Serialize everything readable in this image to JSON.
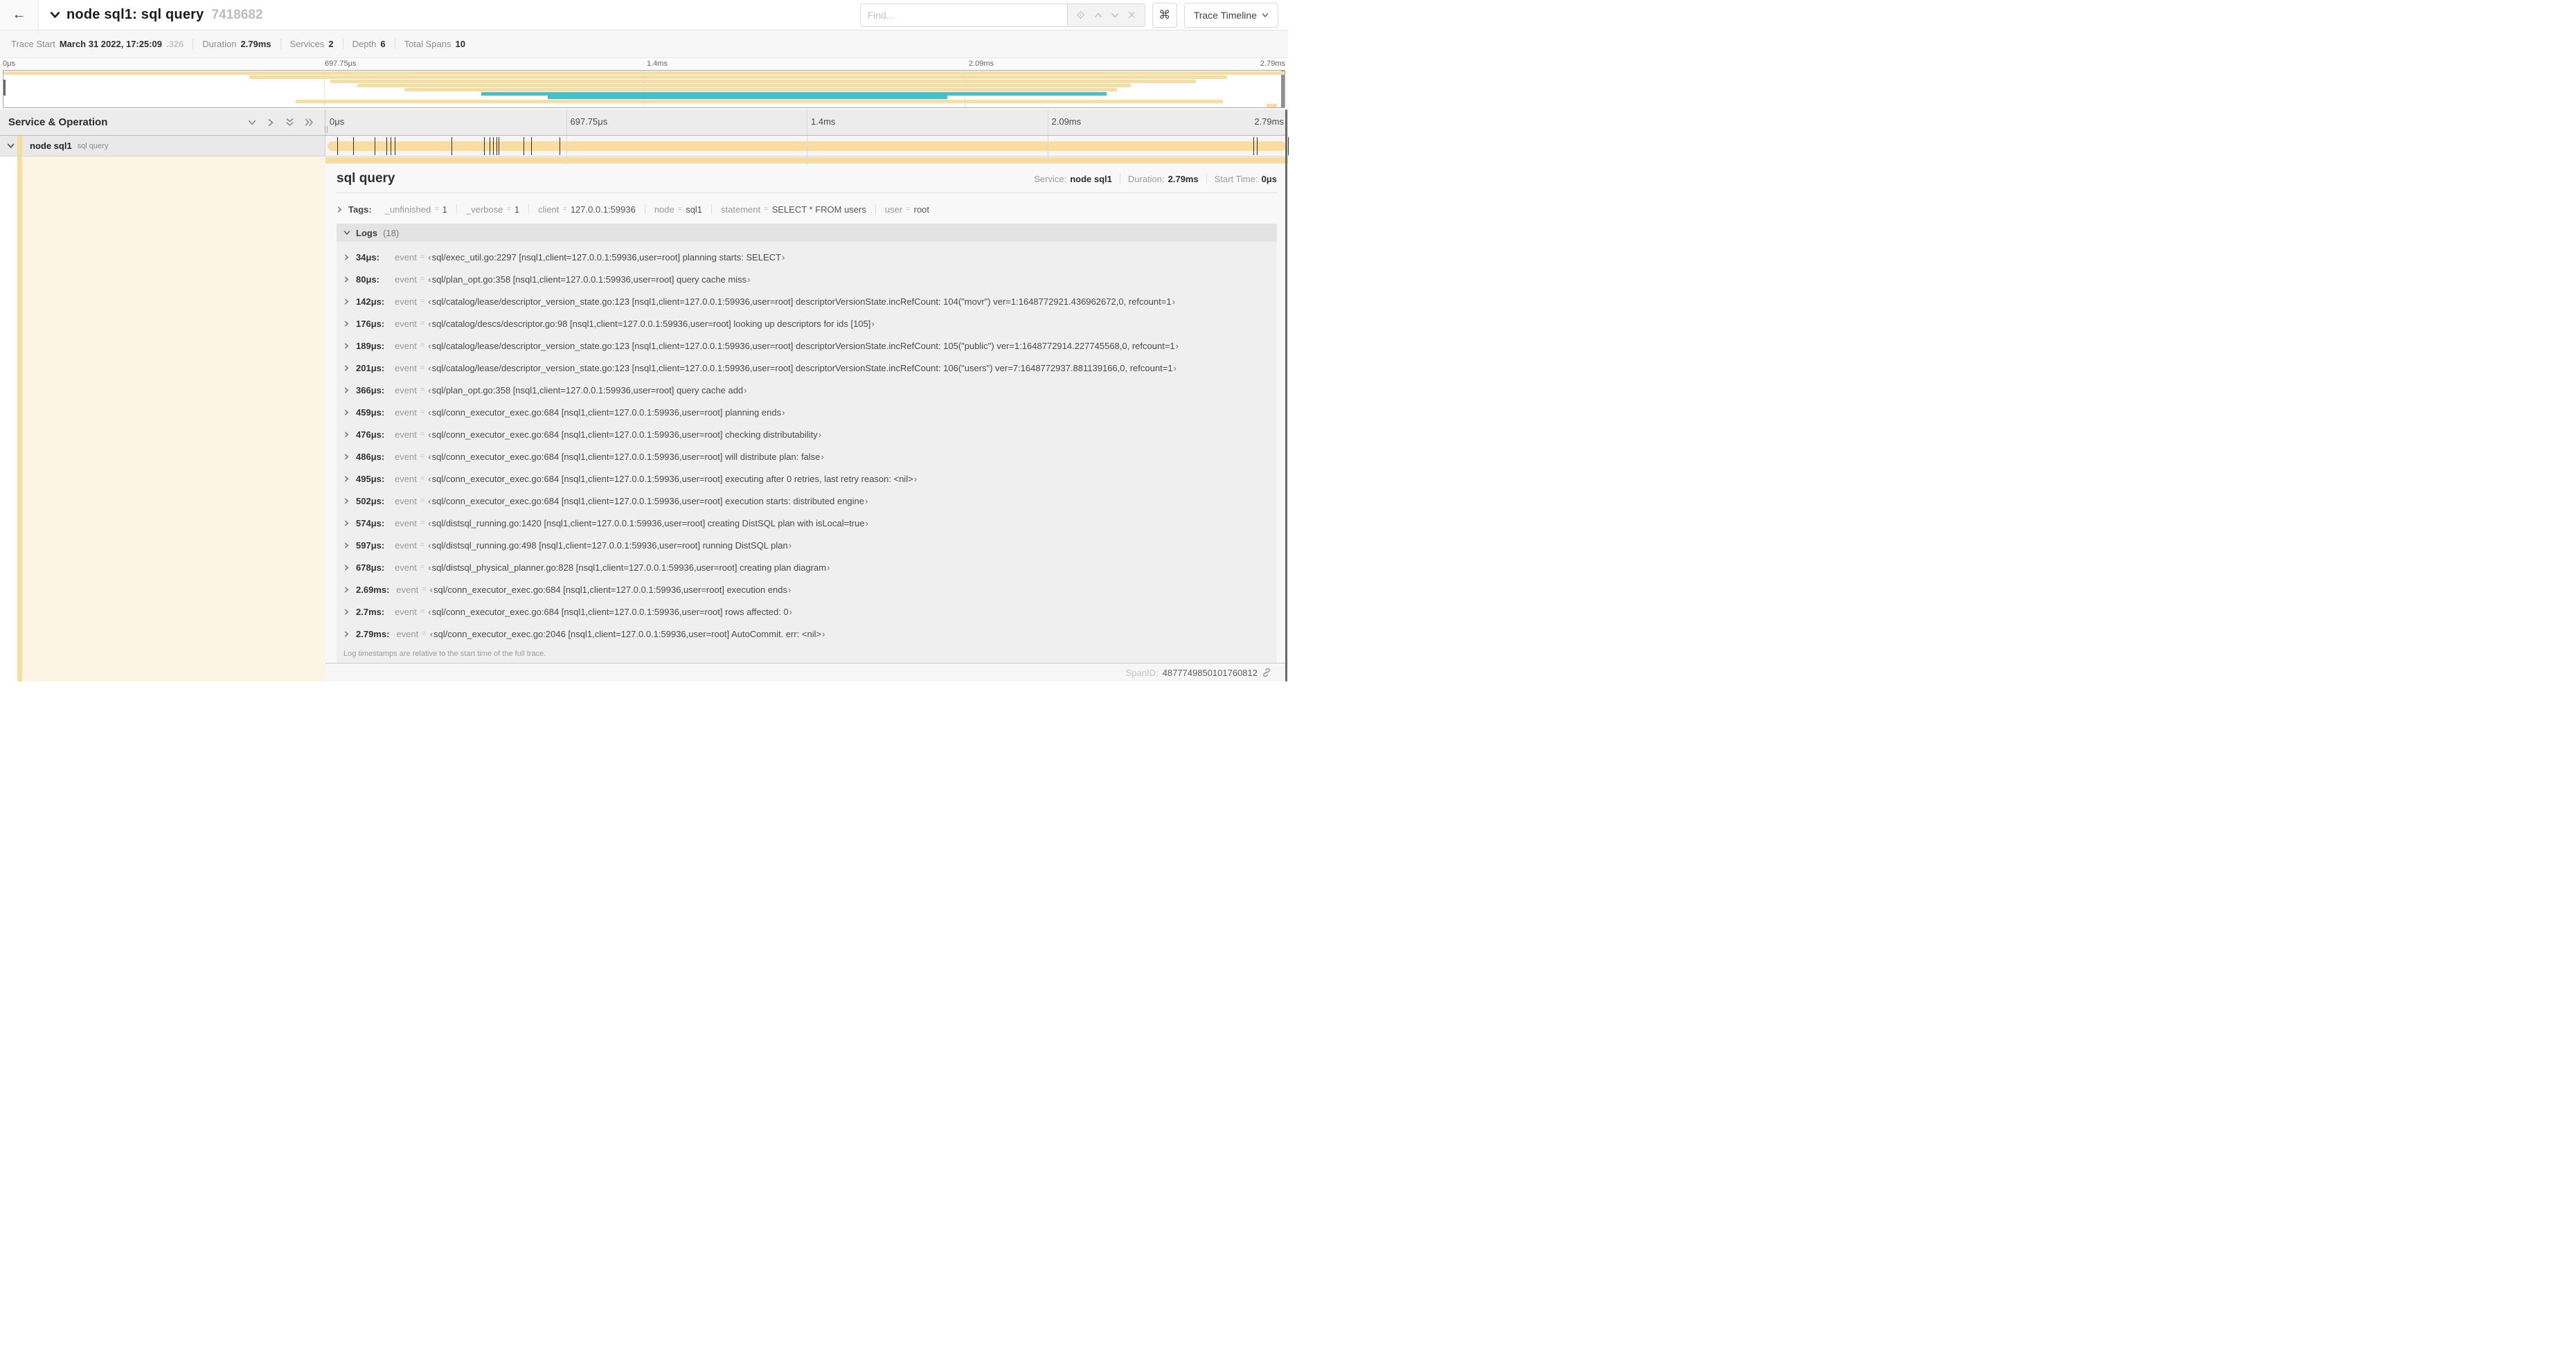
{
  "header": {
    "title": "node sql1: sql query",
    "trace_id": "7418682",
    "find_placeholder": "Find...",
    "view_button": "Trace Timeline",
    "keyboard_shortcut_glyph": "⌘",
    "back_glyph": "←"
  },
  "icons": {
    "back": "arrow-left",
    "title_collapse": "chevron-down",
    "find_target": "crosshair",
    "find_prev": "chevron-up",
    "find_next": "chevron-down",
    "find_clear": "x",
    "keyboard": "command",
    "view_caret": "chevron-down",
    "collapse_one": "chevron-down",
    "expand_one": "chevron-right",
    "collapse_all": "double-chevron-down",
    "expand_all": "double-chevron-right",
    "span_toggle": "chevron-down",
    "tags_toggle": "chevron-right",
    "logs_toggle": "chevron-down",
    "log_row_toggle": "chevron-right",
    "span_link": "link"
  },
  "stats": {
    "items": [
      {
        "label": "Trace Start",
        "value": "March 31 2022, 17:25:09",
        "suffix": ".326"
      },
      {
        "label": "Duration",
        "value": "2.79ms"
      },
      {
        "label": "Services",
        "value": "2"
      },
      {
        "label": "Depth",
        "value": "6"
      },
      {
        "label": "Total Spans",
        "value": "10"
      }
    ]
  },
  "trace": {
    "total_us": 2790
  },
  "minimap": {
    "tick_labels": [
      "0μs",
      "697.75μs",
      "1.4ms",
      "2.09ms",
      "2.79ms"
    ],
    "spans": [
      {
        "row": 0,
        "start": 0,
        "end": 100,
        "color": "yellow"
      },
      {
        "row": 1,
        "start": 19.2,
        "end": 95.5,
        "color": "yellow"
      },
      {
        "row": 2,
        "start": 25.5,
        "end": 93.1,
        "color": "yellow"
      },
      {
        "row": 3,
        "start": 27.6,
        "end": 88.0,
        "color": "yellow"
      },
      {
        "row": 4,
        "start": 31.3,
        "end": 86.9,
        "color": "yellow"
      },
      {
        "row": 5,
        "start": 37.3,
        "end": 86.1,
        "color": "teal"
      },
      {
        "row": 6,
        "start": 42.5,
        "end": 73.7,
        "color": "teal"
      },
      {
        "row": 7,
        "start": 22.8,
        "end": 95.2,
        "color": "yellow"
      },
      {
        "row": 8,
        "start": 98.6,
        "end": 99.4,
        "color": "yellow"
      }
    ]
  },
  "timeline": {
    "left_header": "Service & Operation",
    "axis_ticks": [
      "0μs",
      "697.75μs",
      "1.4ms",
      "2.09ms",
      "2.79ms"
    ]
  },
  "row": {
    "service": "node sql1",
    "operation": "sql query"
  },
  "detail": {
    "title": "sql query",
    "meta": [
      {
        "label": "Service:",
        "value": "node sql1"
      },
      {
        "label": "Duration:",
        "value": "2.79ms"
      },
      {
        "label": "Start Time:",
        "value": "0μs"
      }
    ],
    "tags_label": "Tags:",
    "tags": [
      {
        "key": "_unfinished",
        "value": "1"
      },
      {
        "key": "_verbose",
        "value": "1"
      },
      {
        "key": "client",
        "value": "127.0.0.1:59936"
      },
      {
        "key": "node",
        "value": "sql1"
      },
      {
        "key": "statement",
        "value": "SELECT * FROM users"
      },
      {
        "key": "user",
        "value": "root"
      }
    ],
    "logs_label": "Logs",
    "logs_count": "(18)",
    "logs": [
      {
        "t": "34μs:",
        "t_us": 34,
        "field": "event",
        "value": "sql/exec_util.go:2297 [nsql1,client=127.0.0.1:59936,user=root] planning starts: SELECT"
      },
      {
        "t": "80μs:",
        "t_us": 80,
        "field": "event",
        "value": "sql/plan_opt.go:358 [nsql1,client=127.0.0.1:59936,user=root] query cache miss"
      },
      {
        "t": "142μs:",
        "t_us": 142,
        "field": "event",
        "value": "sql/catalog/lease/descriptor_version_state.go:123 [nsql1,client=127.0.0.1:59936,user=root] descriptorVersionState.incRefCount: 104(\"movr\") ver=1:1648772921.436962672,0, refcount=1"
      },
      {
        "t": "176μs:",
        "t_us": 176,
        "field": "event",
        "value": "sql/catalog/descs/descriptor.go:98 [nsql1,client=127.0.0.1:59936,user=root] looking up descriptors for ids [105]"
      },
      {
        "t": "189μs:",
        "t_us": 189,
        "field": "event",
        "value": "sql/catalog/lease/descriptor_version_state.go:123 [nsql1,client=127.0.0.1:59936,user=root] descriptorVersionState.incRefCount: 105(\"public\") ver=1:1648772914.227745568,0, refcount=1"
      },
      {
        "t": "201μs:",
        "t_us": 201,
        "field": "event",
        "value": "sql/catalog/lease/descriptor_version_state.go:123 [nsql1,client=127.0.0.1:59936,user=root] descriptorVersionState.incRefCount: 106(\"users\") ver=7:1648772937.881139166,0, refcount=1"
      },
      {
        "t": "366μs:",
        "t_us": 366,
        "field": "event",
        "value": "sql/plan_opt.go:358 [nsql1,client=127.0.0.1:59936,user=root] query cache add"
      },
      {
        "t": "459μs:",
        "t_us": 459,
        "field": "event",
        "value": "sql/conn_executor_exec.go:684 [nsql1,client=127.0.0.1:59936,user=root] planning ends"
      },
      {
        "t": "476μs:",
        "t_us": 476,
        "field": "event",
        "value": "sql/conn_executor_exec.go:684 [nsql1,client=127.0.0.1:59936,user=root] checking distributability"
      },
      {
        "t": "486μs:",
        "t_us": 486,
        "field": "event",
        "value": "sql/conn_executor_exec.go:684 [nsql1,client=127.0.0.1:59936,user=root] will distribute plan: false"
      },
      {
        "t": "495μs:",
        "t_us": 495,
        "field": "event",
        "value": "sql/conn_executor_exec.go:684 [nsql1,client=127.0.0.1:59936,user=root] executing after 0 retries, last retry reason: <nil>"
      },
      {
        "t": "502μs:",
        "t_us": 502,
        "field": "event",
        "value": "sql/conn_executor_exec.go:684 [nsql1,client=127.0.0.1:59936,user=root] execution starts: distributed engine"
      },
      {
        "t": "574μs:",
        "t_us": 574,
        "field": "event",
        "value": "sql/distsql_running.go:1420 [nsql1,client=127.0.0.1:59936,user=root] creating DistSQL plan with isLocal=true"
      },
      {
        "t": "597μs:",
        "t_us": 597,
        "field": "event",
        "value": "sql/distsql_running.go:498 [nsql1,client=127.0.0.1:59936,user=root] running DistSQL plan"
      },
      {
        "t": "678μs:",
        "t_us": 678,
        "field": "event",
        "value": "sql/distsql_physical_planner.go:828 [nsql1,client=127.0.0.1:59936,user=root] creating plan diagram"
      },
      {
        "t": "2.69ms:",
        "t_us": 2690,
        "field": "event",
        "value": "sql/conn_executor_exec.go:684 [nsql1,client=127.0.0.1:59936,user=root] execution ends"
      },
      {
        "t": "2.7ms:",
        "t_us": 2700,
        "field": "event",
        "value": "sql/conn_executor_exec.go:684 [nsql1,client=127.0.0.1:59936,user=root] rows affected: 0"
      },
      {
        "t": "2.79ms:",
        "t_us": 2790,
        "field": "event",
        "value": "sql/conn_executor_exec.go:2046 [nsql1,client=127.0.0.1:59936,user=root] AutoCommit. err: <nil>"
      }
    ],
    "footer_note": "Log timestamps are relative to the start time of the full trace.",
    "span_id_label": "SpanID:",
    "span_id": "4877749850101760812"
  },
  "colors": {
    "yellow": "#F8DD9E",
    "teal": "#3FC3C8",
    "cream": "#FDF5E3"
  }
}
